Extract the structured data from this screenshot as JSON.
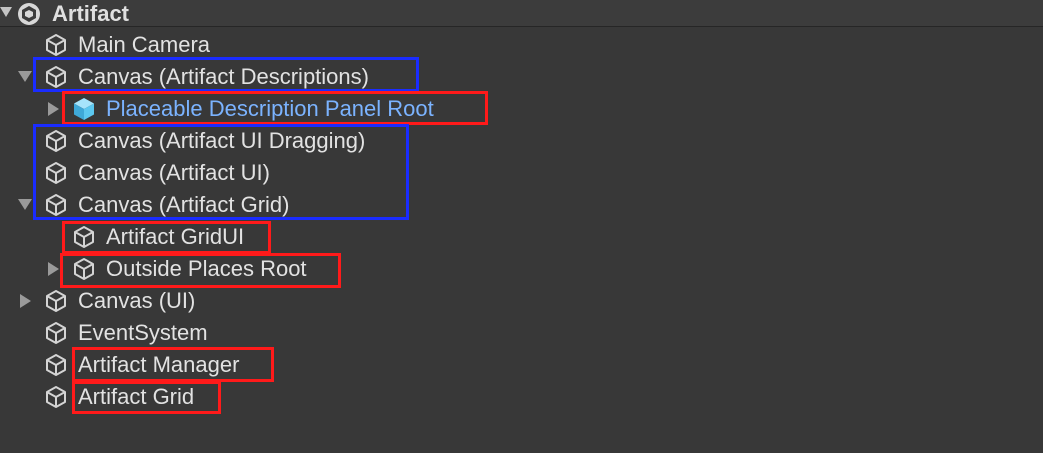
{
  "scene": {
    "title": "Artifact",
    "icon": "unity-scene-icon"
  },
  "hierarchy": [
    {
      "label": "Main Camera",
      "icon": "gameobject-cube-icon",
      "foldout": "none",
      "prefab": false
    },
    {
      "label": "Canvas (Artifact Descriptions)",
      "icon": "gameobject-cube-icon",
      "foldout": "expanded",
      "prefab": false
    },
    {
      "label": "Placeable Description Panel Root",
      "icon": "prefab-cube-icon",
      "foldout": "collapsed",
      "prefab": true
    },
    {
      "label": "Canvas (Artifact UI Dragging)",
      "icon": "gameobject-cube-icon",
      "foldout": "none",
      "prefab": false
    },
    {
      "label": "Canvas (Artifact UI)",
      "icon": "gameobject-cube-icon",
      "foldout": "none",
      "prefab": false
    },
    {
      "label": "Canvas (Artifact Grid)",
      "icon": "gameobject-cube-icon",
      "foldout": "expanded",
      "prefab": false
    },
    {
      "label": "Artifact GridUI",
      "icon": "gameobject-cube-icon",
      "foldout": "none",
      "prefab": false
    },
    {
      "label": "Outside Places Root",
      "icon": "gameobject-cube-icon",
      "foldout": "collapsed",
      "prefab": false
    },
    {
      "label": "Canvas (UI)",
      "icon": "gameobject-cube-icon",
      "foldout": "collapsed",
      "prefab": false
    },
    {
      "label": "EventSystem",
      "icon": "gameobject-cube-icon",
      "foldout": "none",
      "prefab": false
    },
    {
      "label": "Artifact Manager",
      "icon": "gameobject-cube-icon",
      "foldout": "none",
      "prefab": false
    },
    {
      "label": "Artifact Grid",
      "icon": "gameobject-cube-icon",
      "foldout": "none",
      "prefab": false
    }
  ],
  "annotations": {
    "blue": "#1a2cff",
    "red": "#ff1a1a"
  },
  "colors": {
    "background": "#383838",
    "text": "#e2e2e2",
    "prefab_text": "#7bb3ff",
    "prefab_icon": "#5cc8f0"
  }
}
